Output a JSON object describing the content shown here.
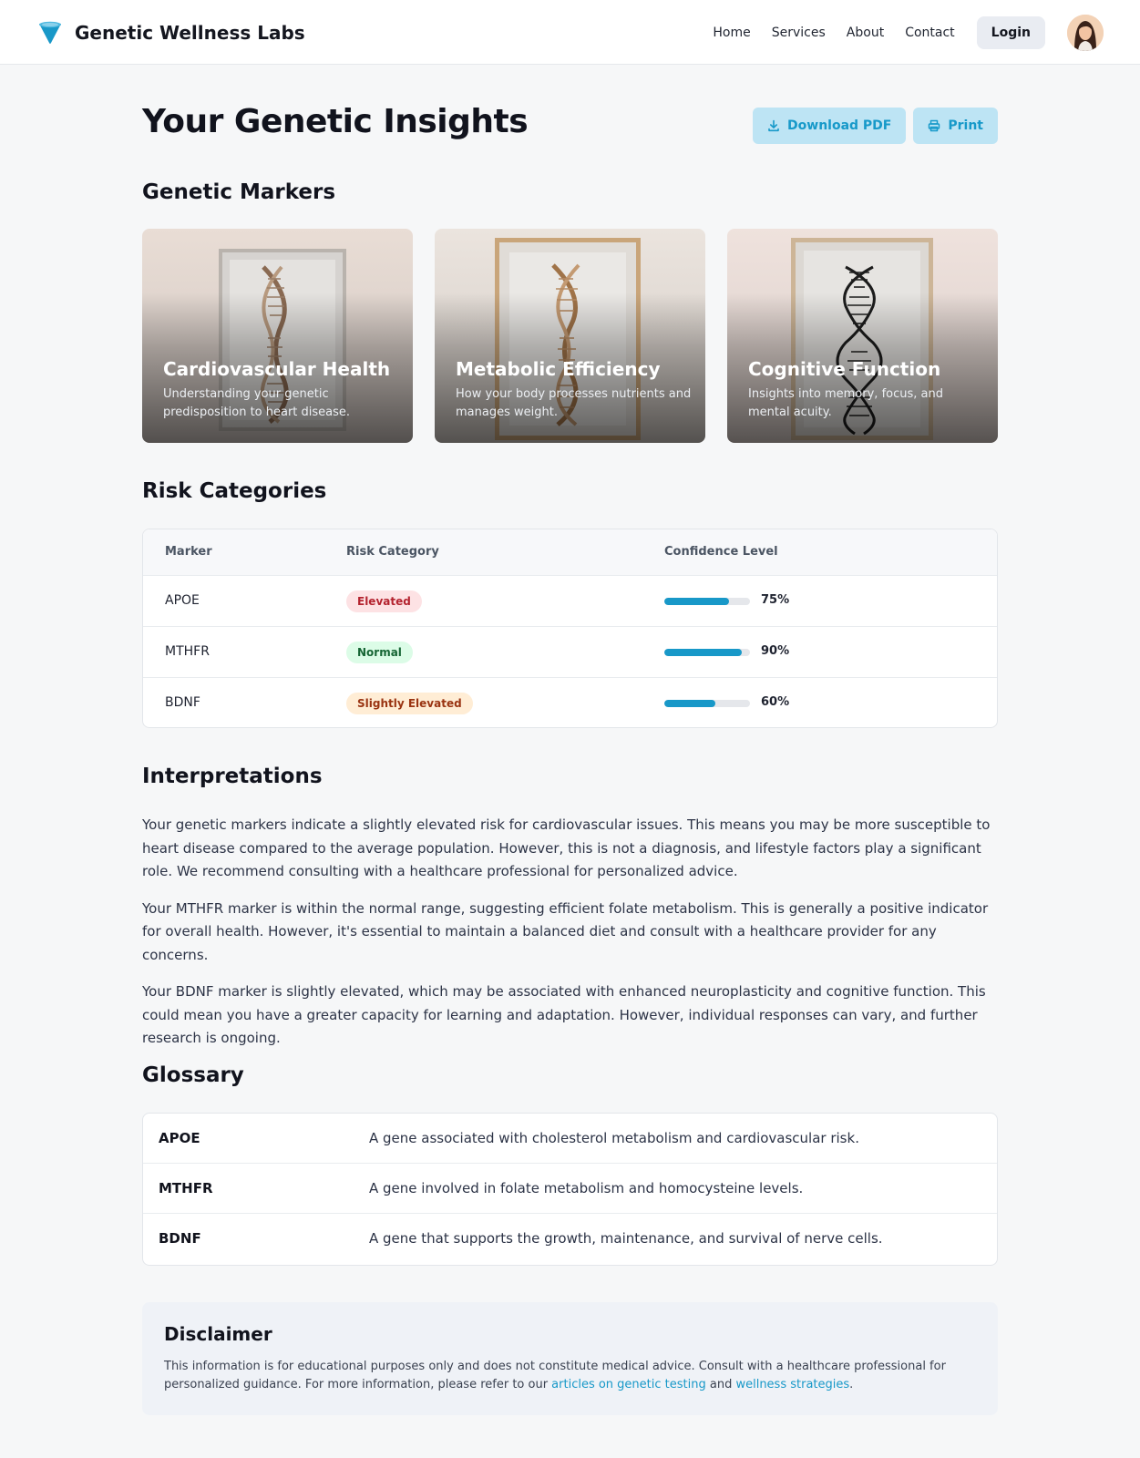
{
  "header": {
    "brand_name": "Genetic Wellness Labs",
    "nav": [
      "Home",
      "Services",
      "About",
      "Contact"
    ],
    "login_label": "Login"
  },
  "page": {
    "title": "Your Genetic Insights",
    "download_label": "Download PDF",
    "print_label": "Print"
  },
  "markers_section": {
    "title": "Genetic Markers",
    "cards": [
      {
        "title": "Cardiovascular Health",
        "description": "Understanding your genetic predisposition to heart disease."
      },
      {
        "title": "Metabolic Efficiency",
        "description": "How your body processes nutrients and manages weight."
      },
      {
        "title": "Cognitive Function",
        "description": "Insights into memory, focus, and mental acuity."
      }
    ]
  },
  "risk_section": {
    "title": "Risk Categories",
    "columns": [
      "Marker",
      "Risk Category",
      "Confidence Level"
    ],
    "rows": [
      {
        "marker": "APOE",
        "category": "Elevated",
        "confidence": 75,
        "confidence_label": "75%"
      },
      {
        "marker": "MTHFR",
        "category": "Normal",
        "confidence": 90,
        "confidence_label": "90%"
      },
      {
        "marker": "BDNF",
        "category": "Slightly Elevated",
        "confidence": 60,
        "confidence_label": "60%"
      }
    ]
  },
  "interpretations": {
    "title": "Interpretations",
    "paragraphs": [
      "Your genetic markers indicate a slightly elevated risk for cardiovascular issues. This means you may be more susceptible to heart disease compared to the average population. However, this is not a diagnosis, and lifestyle factors play a significant role. We recommend consulting with a healthcare professional for personalized advice.",
      "Your MTHFR marker is within the normal range, suggesting efficient folate metabolism. This is generally a positive indicator for overall health. However, it's essential to maintain a balanced diet and consult with a healthcare provider for any concerns.",
      "Your BDNF marker is slightly elevated, which may be associated with enhanced neuroplasticity and cognitive function. This could mean you have a greater capacity for learning and adaptation. However, individual responses can vary, and further research is ongoing."
    ]
  },
  "glossary": {
    "title": "Glossary",
    "items": [
      {
        "term": "APOE",
        "definition": "A gene associated with cholesterol metabolism and cardiovascular risk."
      },
      {
        "term": "MTHFR",
        "definition": "A gene involved in folate metabolism and homocysteine levels."
      },
      {
        "term": "BDNF",
        "definition": "A gene that supports the growth, maintenance, and survival of nerve cells."
      }
    ]
  },
  "disclaimer": {
    "title": "Disclaimer",
    "text_before": "This information is for educational purposes only and does not constitute medical advice. Consult with a healthcare professional for personalized guidance. For more information, please refer to our ",
    "link1": "articles on genetic testing",
    "text_middle": " and ",
    "link2": "wellness strategies",
    "text_after": "."
  },
  "colors": {
    "accent": "#1898c8",
    "badge_elevated_bg": "#fde2e4",
    "badge_elevated_fg": "#b4232f",
    "badge_normal_bg": "#dcfce7",
    "badge_normal_fg": "#166534",
    "badge_slight_bg": "#ffedd5",
    "badge_slight_fg": "#9a3412"
  },
  "icons": {
    "brand": "funnel-logo-icon",
    "download": "download-icon",
    "print": "printer-icon"
  }
}
